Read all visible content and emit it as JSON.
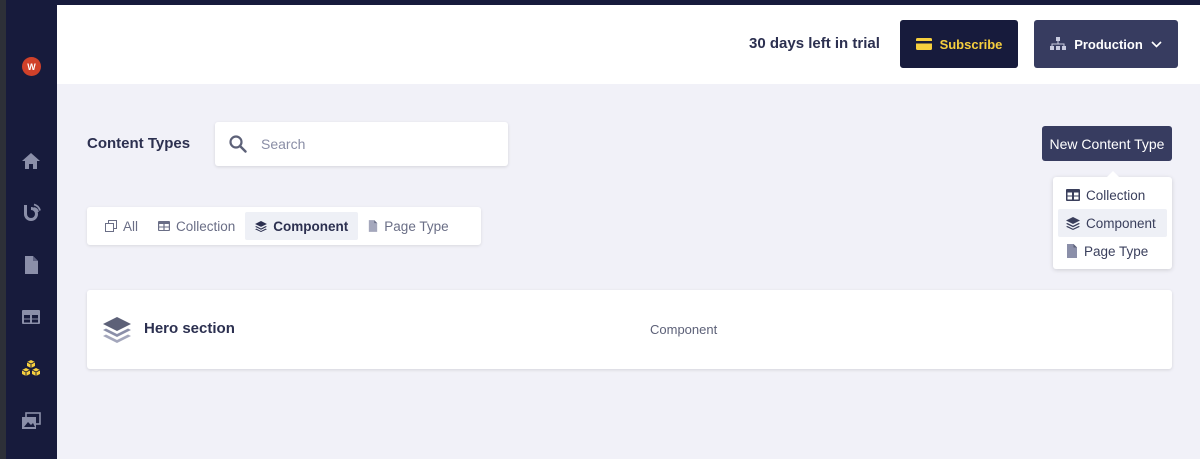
{
  "colors": {
    "sidebar": "#171b3c",
    "accent_yellow": "#f6cf3e",
    "primary_button": "#373c60",
    "avatar": "#d0412a",
    "background": "#f1f1f8"
  },
  "sidebar": {
    "avatar_initial": "W",
    "items": [
      {
        "icon": "home-icon",
        "active": false
      },
      {
        "icon": "blog-icon",
        "active": false
      },
      {
        "icon": "document-icon",
        "active": false
      },
      {
        "icon": "layout-icon",
        "active": false
      },
      {
        "icon": "cubes-icon",
        "active": true
      },
      {
        "icon": "media-icon",
        "active": false
      }
    ]
  },
  "header": {
    "trial_text": "30 days left in trial",
    "subscribe_label": "Subscribe",
    "environment_label": "Production"
  },
  "content": {
    "title": "Content Types",
    "search_placeholder": "Search",
    "new_button_label": "New Content Type",
    "tabs": [
      {
        "label": "All",
        "icon": "copy-icon",
        "active": false
      },
      {
        "label": "Collection",
        "icon": "table-icon",
        "active": false
      },
      {
        "label": "Component",
        "icon": "layers-icon",
        "active": true
      },
      {
        "label": "Page Type",
        "icon": "page-icon",
        "active": false
      }
    ],
    "dropdown": [
      {
        "label": "Collection",
        "icon": "table-icon",
        "active": false
      },
      {
        "label": "Component",
        "icon": "layers-icon",
        "active": true
      },
      {
        "label": "Page Type",
        "icon": "page-icon",
        "active": false
      }
    ],
    "rows": [
      {
        "name": "Hero section",
        "type": "Component",
        "icon": "layers-icon"
      }
    ]
  }
}
